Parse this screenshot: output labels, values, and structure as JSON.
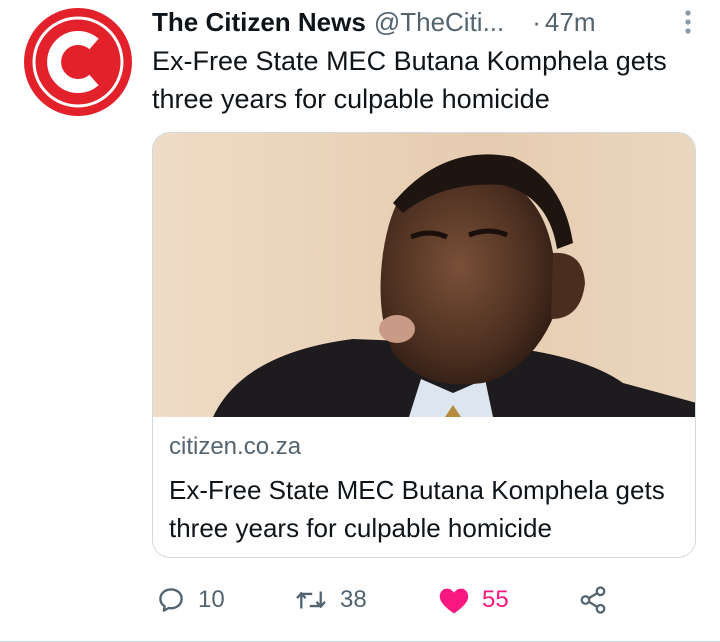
{
  "tweet": {
    "account_name": "The Citizen News",
    "handle": "@TheCiti...",
    "dot": "·",
    "time": "47m",
    "text": "Ex-Free State MEC Butana Komphela gets three years for culpable homicide",
    "card": {
      "domain": "citizen.co.za",
      "title": "Ex-Free State MEC Butana Komphela gets three years for culpable homicide"
    },
    "actions": {
      "replies": "10",
      "retweets": "38",
      "likes": "55"
    }
  },
  "colors": {
    "brand_red": "#e3212b",
    "like_pink": "#f91880",
    "muted_gray": "#536471"
  },
  "icons": [
    "citizen-logo-icon",
    "more-icon",
    "reply-icon",
    "retweet-icon",
    "like-icon",
    "share-icon"
  ]
}
